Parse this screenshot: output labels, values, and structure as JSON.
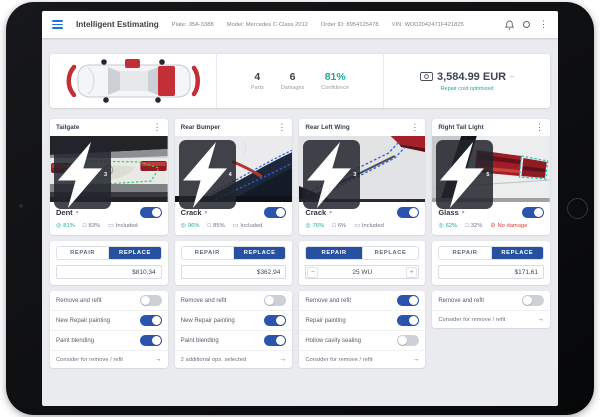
{
  "icons": {
    "kebab": "⋮",
    "caret_down": "▾",
    "arrow_right": "→",
    "collapse_dash": "–",
    "stat_icon_names": [
      "confidence",
      "panel",
      "cost",
      "no-damage"
    ]
  },
  "colors": {
    "accent_blue": "#2b55ad",
    "active_tab_navy": "#27509e",
    "teal": "#1fa99b",
    "alert_red": "#e0403c",
    "hamburger_blue": "#1a73e8"
  },
  "topbar": {
    "title": "Intelligent Estimating",
    "meta": [
      "Plate: JBA-3388",
      "Model: Mercedes C-Class 2012",
      "Order ID: 8954125478",
      "VIN: WDD2042471F421825"
    ]
  },
  "summary": {
    "stats": [
      {
        "value": "4",
        "label": "Parts",
        "tone": "dark"
      },
      {
        "value": "6",
        "label": "Damages",
        "tone": "dark"
      },
      {
        "value": "81%",
        "label": "Confidence",
        "tone": "teal"
      }
    ],
    "total_amount": "3,584.99 EUR",
    "total_note": "Repair cost optimized"
  },
  "cards": [
    {
      "title": "Tailgate",
      "photo_count": "3",
      "damage_type": "Dent",
      "damage_on": true,
      "stats": [
        {
          "icon": "confidence",
          "text": "81%",
          "tone": "teal"
        },
        {
          "icon": "panel",
          "text": "83%",
          "tone": "gray"
        },
        {
          "icon": "cost",
          "text": "Included",
          "tone": "gray"
        }
      ],
      "tabs": [
        {
          "label": "REPAIR",
          "active": false
        },
        {
          "label": "REPLACE",
          "active": true
        }
      ],
      "price": "$810,34",
      "operations": [
        {
          "label": "Remove and refit",
          "on": false
        },
        {
          "label": "New Repair painting",
          "on": true
        },
        {
          "label": "Paint blending",
          "on": true
        }
      ],
      "footer": "Consider for remove / refit"
    },
    {
      "title": "Rear Bumper",
      "photo_count": "4",
      "damage_type": "Crack",
      "damage_on": true,
      "stats": [
        {
          "icon": "confidence",
          "text": "96%",
          "tone": "teal"
        },
        {
          "icon": "panel",
          "text": "85%",
          "tone": "gray"
        },
        {
          "icon": "cost",
          "text": "Included",
          "tone": "gray"
        }
      ],
      "tabs": [
        {
          "label": "REPAIR",
          "active": false
        },
        {
          "label": "REPLACE",
          "active": true
        }
      ],
      "price": "$362,94",
      "operations": [
        {
          "label": "Remove and refit",
          "on": false
        },
        {
          "label": "New Repair painting",
          "on": true
        },
        {
          "label": "Paint blending",
          "on": true
        }
      ],
      "footer": "2 additional ops. selected"
    },
    {
      "title": "Rear Left Wing",
      "photo_count": "3",
      "damage_type": "Crack",
      "damage_on": true,
      "stats": [
        {
          "icon": "confidence",
          "text": "76%",
          "tone": "teal"
        },
        {
          "icon": "panel",
          "text": "6%",
          "tone": "gray"
        },
        {
          "icon": "cost",
          "text": "Included",
          "tone": "gray"
        }
      ],
      "tabs": [
        {
          "label": "REPAIR",
          "active": true
        },
        {
          "label": "REPLACE",
          "active": false
        }
      ],
      "stepper": {
        "decrease": "−",
        "value": "25 WU",
        "increase": "+"
      },
      "operations": [
        {
          "label": "Remove and refit",
          "on": true
        },
        {
          "label": "Repair painting",
          "on": true
        },
        {
          "label": "Hollow cavity sealing",
          "on": false
        }
      ],
      "footer": "Consider for remove / refit"
    },
    {
      "title": "Right Tail Light",
      "photo_count": "5",
      "damage_type": "Glass",
      "damage_on": true,
      "stats": [
        {
          "icon": "confidence",
          "text": "62%",
          "tone": "teal"
        },
        {
          "icon": "panel",
          "text": "32%",
          "tone": "gray"
        },
        {
          "icon": "no-damage",
          "text": "No damage",
          "tone": "red"
        }
      ],
      "tabs": [
        {
          "label": "REPAIR",
          "active": false
        },
        {
          "label": "REPLACE",
          "active": true
        }
      ],
      "price": "$171,61",
      "operations": [
        {
          "label": "Remove and refit",
          "on": false
        }
      ],
      "footer": "Consider for remove / refit"
    }
  ]
}
